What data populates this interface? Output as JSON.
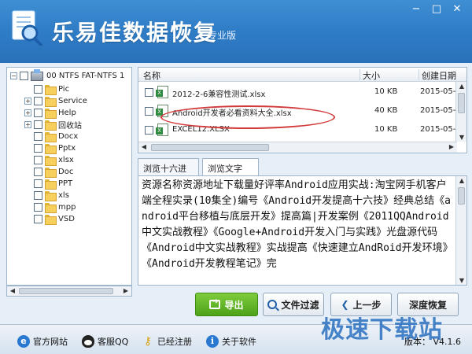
{
  "window": {
    "title": "乐易佳数据恢复",
    "edition": "专业版",
    "controls": {
      "minimize": "−",
      "maximize": "□",
      "close": "✕"
    }
  },
  "tree": {
    "root": "00  NTFS  FAT-NTFS  1",
    "items": [
      {
        "label": "Pic",
        "expandable": false
      },
      {
        "label": "Service",
        "expandable": true
      },
      {
        "label": "Help",
        "expandable": true
      },
      {
        "label": "回收站",
        "expandable": true
      },
      {
        "label": "Docx",
        "expandable": false
      },
      {
        "label": "Pptx",
        "expandable": false
      },
      {
        "label": "xlsx",
        "expandable": false
      },
      {
        "label": "Doc",
        "expandable": false
      },
      {
        "label": "PPT",
        "expandable": false
      },
      {
        "label": "xls",
        "expandable": false
      },
      {
        "label": "mpp",
        "expandable": false
      },
      {
        "label": "VSD",
        "expandable": false
      }
    ]
  },
  "filelist": {
    "columns": {
      "name": "名称",
      "size": "大小",
      "date": "创建日期"
    },
    "rows": [
      {
        "name": "2012-2-6兼容性测试.xlsx",
        "size": "10 KB",
        "date": "2015-05-"
      },
      {
        "name": "Android开发者必看资料大全.xlsx",
        "size": "40 KB",
        "date": "2015-05-"
      },
      {
        "name": "EXCEL12.XLSX",
        "size": "10 KB",
        "date": "2015-05-"
      }
    ]
  },
  "tabs": [
    {
      "label": "浏览十六进制",
      "active": false
    },
    {
      "label": "浏览文字",
      "active": true
    }
  ],
  "preview": {
    "text": "资源名称资源地址下载量好评率Android应用实战:淘宝网手机客户端全程实录(10集全)编号《Android开发提高十六技》经典总结《android平台移植与底层开发》提高篇|开发案例《2011QQAndroid中文实战教程》《Google+Android开发入门与实践》光盘源代码《Android中文实战教程》实战提高《快速建立AndRoid开发环境》《Android开发教程笔记》完"
  },
  "actions": {
    "export": "导出",
    "filter": "文件过滤",
    "prev": "上一步",
    "deep": "深度恢复"
  },
  "footer": {
    "website": "官方网站",
    "support": "客服QQ",
    "registered": "已经注册",
    "about": "关于软件",
    "version": "版本： V4.1.6"
  },
  "watermark": "极速下载站",
  "colors": {
    "titlebar": "#2f7cc6",
    "export_button": "#5aae22",
    "highlight": "#d23a3a"
  }
}
